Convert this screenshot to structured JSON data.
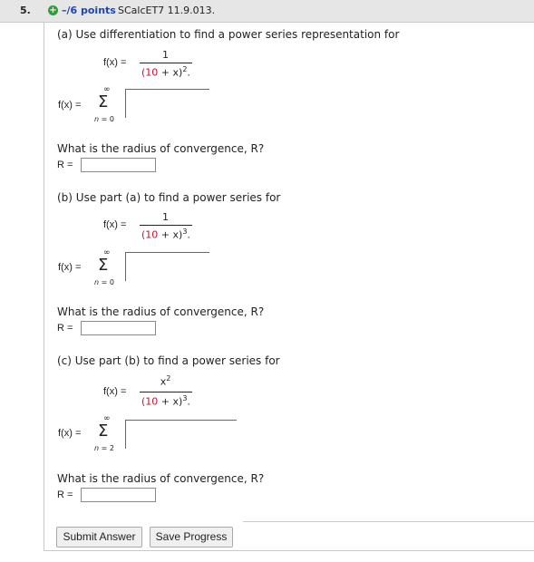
{
  "question": {
    "number": "5.",
    "points": "–/6 points",
    "problem_id": "SCalcET7 11.9.013."
  },
  "parts": [
    {
      "title": "(a) Use differentiation to find a power series representation for",
      "fx": "f(x) =",
      "numerator": "1",
      "den_a": "(10",
      "den_b": " + x)",
      "den_exp": "2",
      "den_end": ".",
      "sum_fx": "f(x) =",
      "sum_upper": "∞",
      "sigma": "Σ",
      "n_var": "n",
      "n_eq": " = 0",
      "radius_question": "What is the radius of convergence, R?",
      "r_label": "R ="
    },
    {
      "title": "(b) Use part (a) to find a power series for",
      "fx": "f(x) =",
      "numerator": "1",
      "den_a": "(10",
      "den_b": " + x)",
      "den_exp": "3",
      "den_end": ".",
      "sum_fx": "f(x) =",
      "sum_upper": "∞",
      "sigma": "Σ",
      "n_var": "n",
      "n_eq": " = 0",
      "radius_question": "What is the radius of convergence, R?",
      "r_label": "R ="
    },
    {
      "title": "(c) Use part (b) to find a power series for",
      "fx": "f(x) =",
      "numerator": "x",
      "num_exp": "2",
      "den_a": "(10",
      "den_b": " + x)",
      "den_exp": "3",
      "den_end": ".",
      "sum_fx": "f(x) =",
      "sum_upper": "∞",
      "sigma": "Σ",
      "n_var": "n",
      "n_eq": " = 2",
      "radius_question": "What is the radius of convergence, R?",
      "r_label": "R ="
    }
  ],
  "buttons": {
    "submit": "Submit Answer",
    "save": "Save Progress"
  }
}
